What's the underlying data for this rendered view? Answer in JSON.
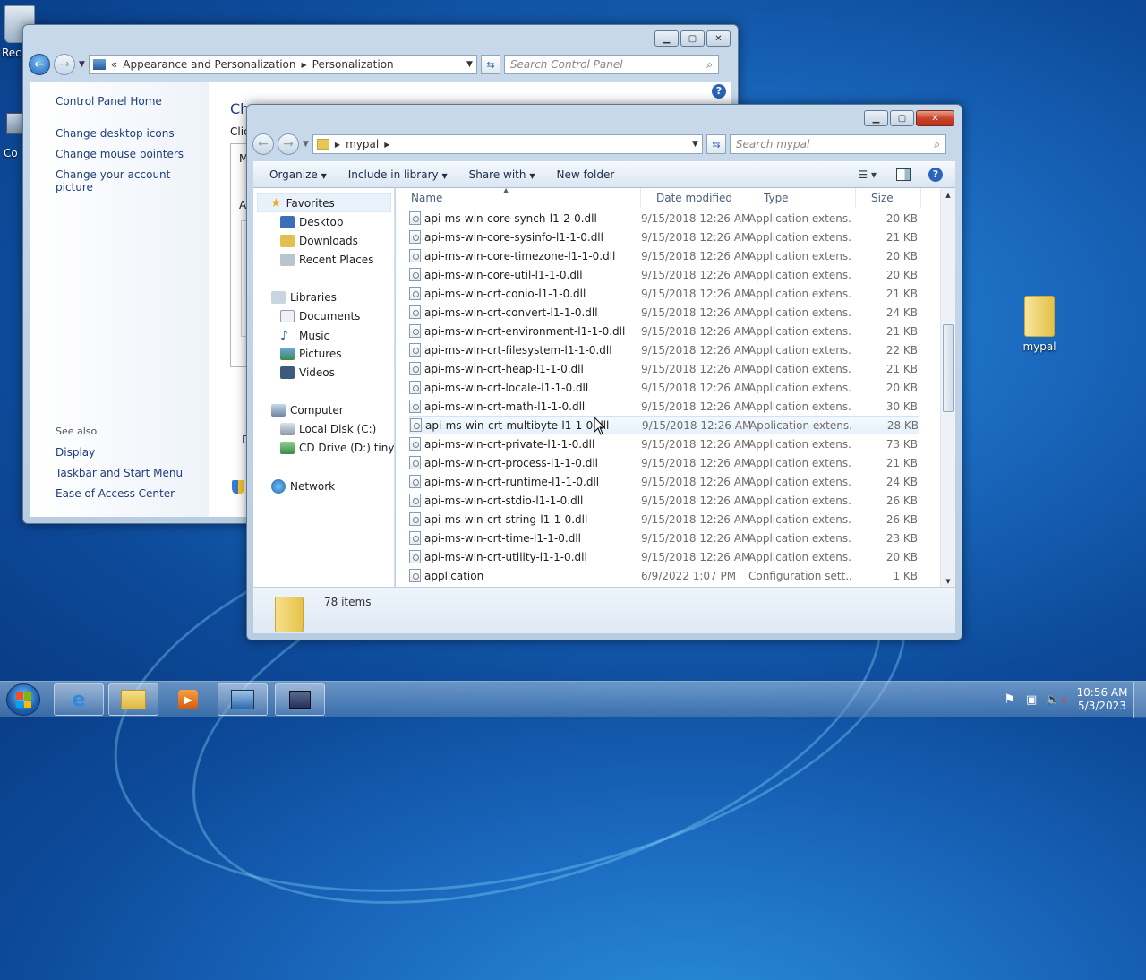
{
  "desktop": {
    "icons": [
      {
        "label": "Rec",
        "icon": "recycle-bin-icon"
      },
      {
        "label": "Co",
        "icon": "computer-icon"
      },
      {
        "label": "mypal",
        "icon": "folder-icon"
      }
    ]
  },
  "control_panel": {
    "breadcrumb": [
      "Appearance and Personalization",
      "Personalization"
    ],
    "search_placeholder": "Search Control Panel",
    "left_links": [
      "Control Panel Home",
      "Change desktop icons",
      "Change mouse pointers",
      "Change your account picture"
    ],
    "see_also_title": "See also",
    "see_also": [
      "Display",
      "Taskbar and Start Menu",
      "Ease of Access Center"
    ],
    "main_partial": [
      "Ch",
      "Clic",
      "M",
      "A",
      "D"
    ]
  },
  "explorer": {
    "address": "mypal",
    "search_placeholder": "Search mypal",
    "toolbar": {
      "organize": "Organize",
      "include": "Include in library",
      "share": "Share with",
      "new_folder": "New folder"
    },
    "nav": {
      "favorites": "Favorites",
      "favorites_items": [
        "Desktop",
        "Downloads",
        "Recent Places"
      ],
      "libraries": "Libraries",
      "libraries_items": [
        "Documents",
        "Music",
        "Pictures",
        "Videos"
      ],
      "computer": "Computer",
      "computer_items": [
        "Local Disk (C:)",
        "CD Drive (D:) tiny11"
      ],
      "network": "Network"
    },
    "columns": {
      "name": "Name",
      "date": "Date modified",
      "type": "Type",
      "size": "Size"
    },
    "files": [
      {
        "name": "api-ms-win-core-synch-l1-2-0.dll",
        "date": "9/15/2018 12:26 AM",
        "type": "Application extens...",
        "size": "20 KB"
      },
      {
        "name": "api-ms-win-core-sysinfo-l1-1-0.dll",
        "date": "9/15/2018 12:26 AM",
        "type": "Application extens...",
        "size": "21 KB"
      },
      {
        "name": "api-ms-win-core-timezone-l1-1-0.dll",
        "date": "9/15/2018 12:26 AM",
        "type": "Application extens...",
        "size": "20 KB"
      },
      {
        "name": "api-ms-win-core-util-l1-1-0.dll",
        "date": "9/15/2018 12:26 AM",
        "type": "Application extens...",
        "size": "20 KB"
      },
      {
        "name": "api-ms-win-crt-conio-l1-1-0.dll",
        "date": "9/15/2018 12:26 AM",
        "type": "Application extens...",
        "size": "21 KB"
      },
      {
        "name": "api-ms-win-crt-convert-l1-1-0.dll",
        "date": "9/15/2018 12:26 AM",
        "type": "Application extens...",
        "size": "24 KB"
      },
      {
        "name": "api-ms-win-crt-environment-l1-1-0.dll",
        "date": "9/15/2018 12:26 AM",
        "type": "Application extens...",
        "size": "21 KB"
      },
      {
        "name": "api-ms-win-crt-filesystem-l1-1-0.dll",
        "date": "9/15/2018 12:26 AM",
        "type": "Application extens...",
        "size": "22 KB"
      },
      {
        "name": "api-ms-win-crt-heap-l1-1-0.dll",
        "date": "9/15/2018 12:26 AM",
        "type": "Application extens...",
        "size": "21 KB"
      },
      {
        "name": "api-ms-win-crt-locale-l1-1-0.dll",
        "date": "9/15/2018 12:26 AM",
        "type": "Application extens...",
        "size": "20 KB"
      },
      {
        "name": "api-ms-win-crt-math-l1-1-0.dll",
        "date": "9/15/2018 12:26 AM",
        "type": "Application extens...",
        "size": "30 KB"
      },
      {
        "name": "api-ms-win-crt-multibyte-l1-1-0.dll",
        "date": "9/15/2018 12:26 AM",
        "type": "Application extens...",
        "size": "28 KB"
      },
      {
        "name": "api-ms-win-crt-private-l1-1-0.dll",
        "date": "9/15/2018 12:26 AM",
        "type": "Application extens...",
        "size": "73 KB"
      },
      {
        "name": "api-ms-win-crt-process-l1-1-0.dll",
        "date": "9/15/2018 12:26 AM",
        "type": "Application extens...",
        "size": "21 KB"
      },
      {
        "name": "api-ms-win-crt-runtime-l1-1-0.dll",
        "date": "9/15/2018 12:26 AM",
        "type": "Application extens...",
        "size": "24 KB"
      },
      {
        "name": "api-ms-win-crt-stdio-l1-1-0.dll",
        "date": "9/15/2018 12:26 AM",
        "type": "Application extens...",
        "size": "26 KB"
      },
      {
        "name": "api-ms-win-crt-string-l1-1-0.dll",
        "date": "9/15/2018 12:26 AM",
        "type": "Application extens...",
        "size": "26 KB"
      },
      {
        "name": "api-ms-win-crt-time-l1-1-0.dll",
        "date": "9/15/2018 12:26 AM",
        "type": "Application extens...",
        "size": "23 KB"
      },
      {
        "name": "api-ms-win-crt-utility-l1-1-0.dll",
        "date": "9/15/2018 12:26 AM",
        "type": "Application extens...",
        "size": "20 KB"
      },
      {
        "name": "application",
        "date": "6/9/2022 1:07 PM",
        "type": "Configuration sett...",
        "size": "1 KB"
      }
    ],
    "item_count": "78 items"
  },
  "taskbar": {
    "items": [
      "internet-explorer-icon",
      "windows-explorer-icon",
      "media-player-icon",
      "control-panel-icon",
      "desktop-app-icon"
    ],
    "time": "10:56 AM",
    "date": "5/3/2023"
  },
  "colors": {
    "accent": "#1b64b5",
    "link": "#1e3f7a",
    "close": "#c9442a"
  }
}
